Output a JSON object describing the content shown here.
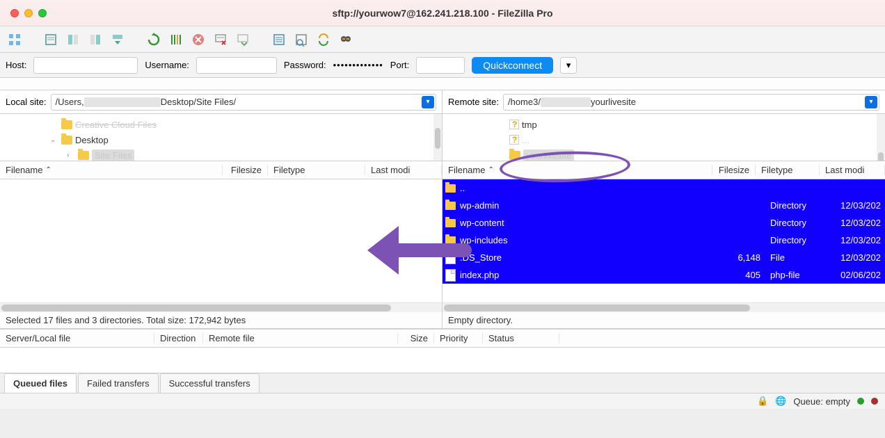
{
  "title": "sftp://yourwow7@162.241.218.100 - FileZilla Pro",
  "connect": {
    "host_label": "Host:",
    "user_label": "Username:",
    "pass_label": "Password:",
    "pass_value": "•••••••••••••",
    "port_label": "Port:",
    "quickconnect": "Quickconnect"
  },
  "local": {
    "label": "Local site:",
    "path_prefix": "/Users,",
    "path_suffix": "Desktop/Site Files/",
    "tree": {
      "ccf": "Creative Cloud Files",
      "desktop": "Desktop",
      "sitefiles": "Site Files"
    },
    "cols": [
      "Filename",
      "Filesize",
      "Filetype",
      "Last modi"
    ],
    "status": "Selected 17 files and 3 directories. Total size: 172,942 bytes"
  },
  "remote": {
    "label": "Remote site:",
    "path_prefix": "/home3/",
    "path_suffix": "yourlivesite",
    "tree": {
      "tmp": "tmp",
      "yourlivesite": "yourlivesite"
    },
    "cols": [
      "Filename",
      "Filesize",
      "Filetype",
      "Last modi"
    ],
    "files": [
      {
        "name": "..",
        "size": "",
        "type": "",
        "date": ""
      },
      {
        "name": "wp-admin",
        "size": "",
        "type": "Directory",
        "date": "12/03/202"
      },
      {
        "name": "wp-content",
        "size": "",
        "type": "Directory",
        "date": "12/03/202"
      },
      {
        "name": "wp-includes",
        "size": "",
        "type": "Directory",
        "date": "12/03/202"
      },
      {
        "name": ".DS_Store",
        "size": "6,148",
        "type": "File",
        "date": "12/03/202"
      },
      {
        "name": "index.php",
        "size": "405",
        "type": "php-file",
        "date": "02/06/202"
      }
    ],
    "status": "Empty directory."
  },
  "transfer_cols": [
    "Server/Local file",
    "Direction",
    "Remote file",
    "Size",
    "Priority",
    "Status"
  ],
  "tabs": [
    "Queued files",
    "Failed transfers",
    "Successful transfers"
  ],
  "queue": "Queue: empty"
}
